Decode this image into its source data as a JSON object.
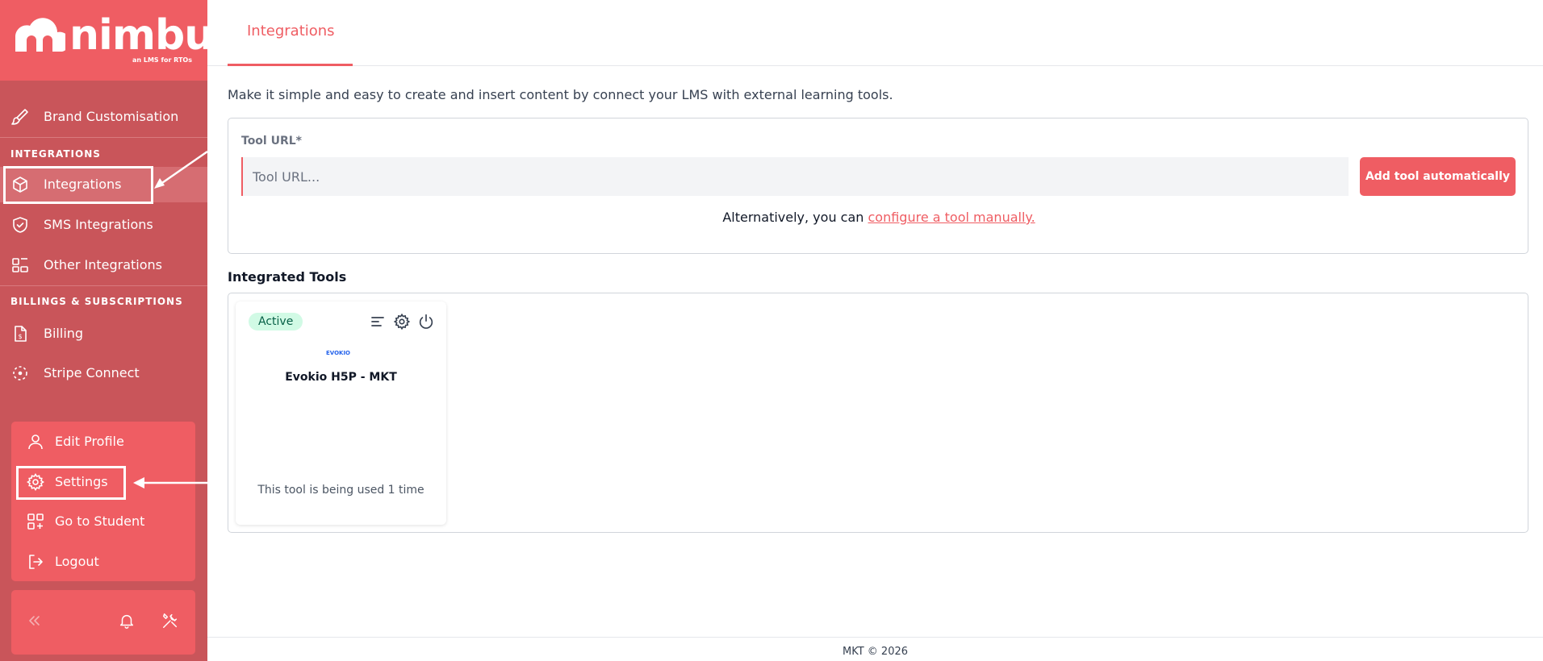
{
  "brand": {
    "name": "nimbu",
    "tagline": "an LMS for RTOs",
    "accent": "#ef5d63",
    "sidebar_bg": "#c9555a"
  },
  "sidebar": {
    "items_top": [
      {
        "label": "Brand Customisation",
        "icon": "paintbrush-icon"
      }
    ],
    "section_integrations": "INTEGRATIONS",
    "integrations_items": [
      {
        "label": "Integrations",
        "icon": "box-icon",
        "active": true
      },
      {
        "label": "SMS Integrations",
        "icon": "shield-check-icon"
      },
      {
        "label": "Other Integrations",
        "icon": "blocks-icon"
      }
    ],
    "section_billing": "BILLINGS & SUBSCRIPTIONS",
    "billing_items": [
      {
        "label": "Billing",
        "icon": "invoice-icon"
      },
      {
        "label": "Stripe Connect",
        "icon": "connect-icon"
      }
    ],
    "account_items": [
      {
        "label": "Edit Profile",
        "icon": "user-icon"
      },
      {
        "label": "Settings",
        "icon": "gear-icon"
      },
      {
        "label": "Go to Student",
        "icon": "grid-plus-icon"
      },
      {
        "label": "Logout",
        "icon": "logout-icon"
      }
    ],
    "tools": [
      "collapse-icon",
      "bell-icon",
      "tools-icon"
    ]
  },
  "header": {
    "tabs": [
      {
        "label": "Integrations",
        "active": true
      }
    ]
  },
  "main": {
    "intro": "Make it simple and easy to create and insert content by connect your LMS with external learning tools.",
    "tool_url": {
      "label": "Tool URL*",
      "placeholder": "Tool URL...",
      "value": ""
    },
    "add_button": "Add tool automatically",
    "alternative_text": "Alternatively, you can ",
    "alternative_link": "configure a tool manually.",
    "integrated_title": "Integrated Tools",
    "tools": [
      {
        "status": "Active",
        "logo_text": "EVOKIO",
        "name": "Evokio H5P - MKT",
        "usage": "This tool is being used 1 time"
      }
    ]
  },
  "footer": {
    "text": "MKT © 2026"
  }
}
